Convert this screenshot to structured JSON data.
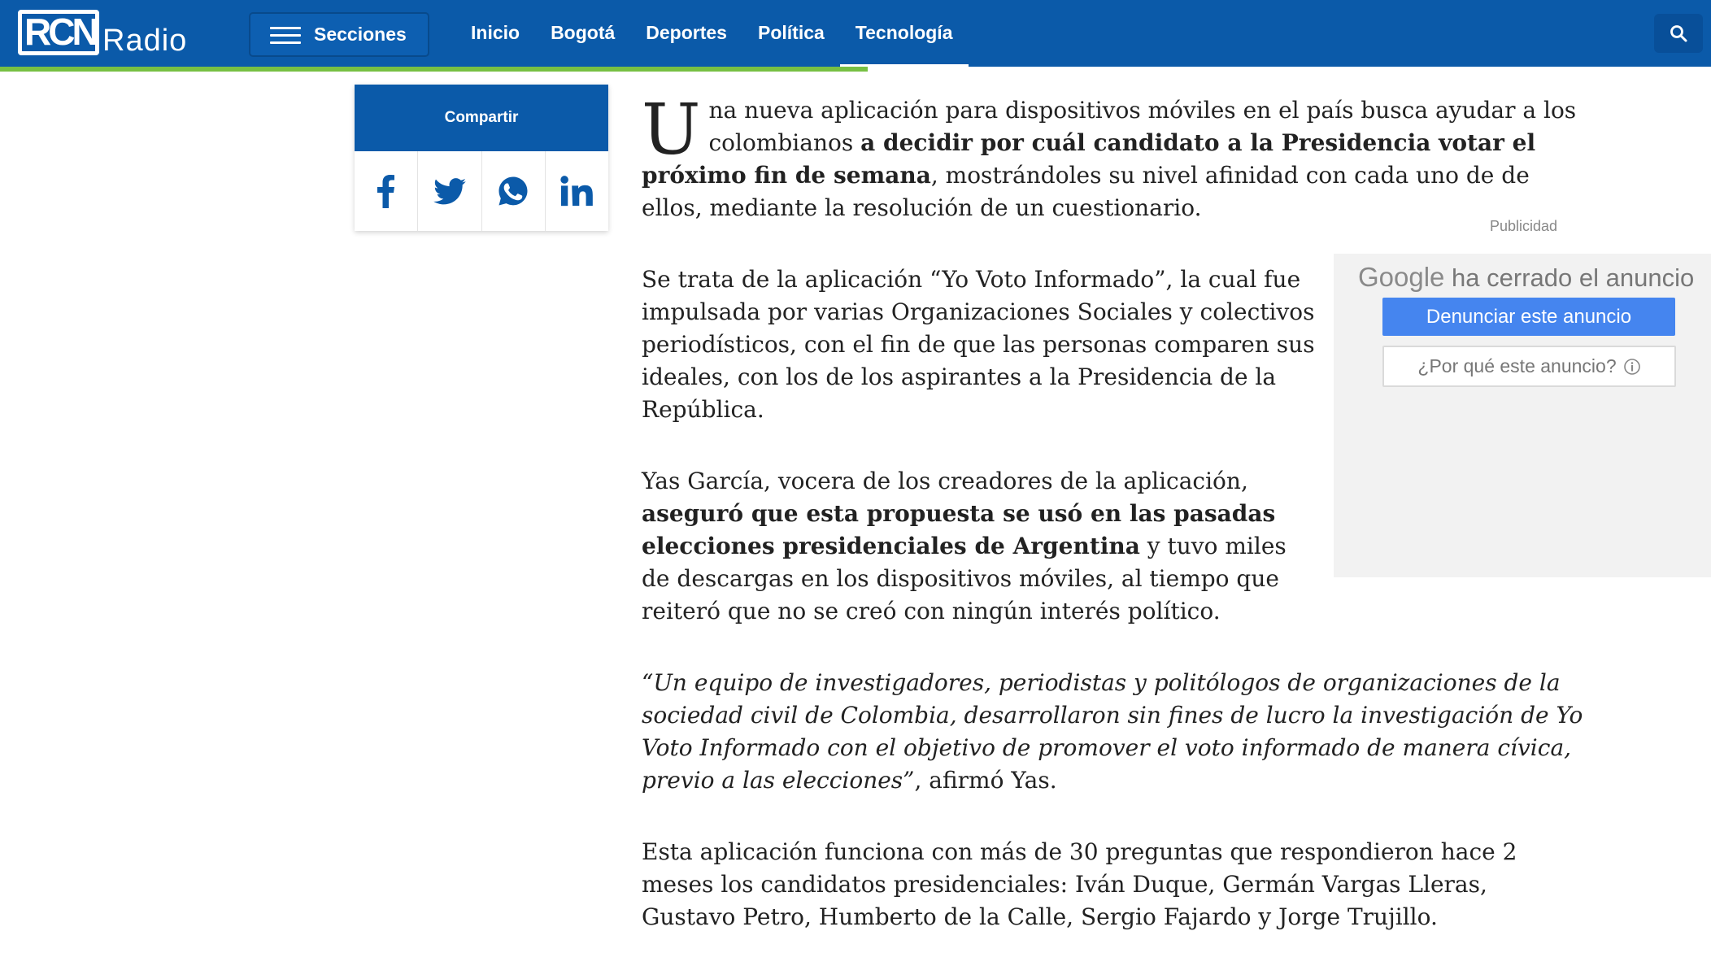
{
  "header": {
    "logo_text": "RCN",
    "logo_word": "Radio",
    "secciones_label": "Secciones",
    "nav": [
      "Inicio",
      "Bogotá",
      "Deportes",
      "Política",
      "Tecnología"
    ],
    "active_nav": "Tecnología",
    "brand_color": "#0b5aa9",
    "progress_color": "#77c043",
    "reading_progress_percent": 50.7
  },
  "share": {
    "label": "Compartir",
    "icons": [
      "facebook-icon",
      "twitter-icon",
      "whatsapp-icon",
      "linkedin-icon"
    ]
  },
  "article": {
    "p1": {
      "dropcap": "U",
      "t1": "na nueva aplicación para dispositivos móviles en el país busca ayudar a los colombianos ",
      "b1": "a decidir por cuál candidato a la Presidencia votar el próximo fin de semana",
      "t2": ", mostrándoles su nivel afinidad con cada uno de de ellos, mediante la resolución de un cuestionario."
    },
    "p2": "Se trata de la aplicación “Yo Voto Informado”, la cual fue impulsada por varias Organizaciones Sociales y colectivos periodísticos, con el fin de que las personas comparen sus ideales, con los de los aspirantes a la Presidencia de la República.",
    "p3": {
      "t1": "Yas García, vocera de los creadores de la aplicación, ",
      "b1": "aseguró que esta propuesta se usó en las pasadas elecciones presidenciales de Argentina",
      "t2": " y tuvo miles de descargas en los dispositivos móviles, al tiempo que reiteró que no se creó con ningún interés político."
    },
    "p4": {
      "quote": "“Un equipo de investigadores, periodistas y politólogos de organizaciones de la sociedad civil de Colombia, desarrollaron sin fines de lucro la investigación de Yo Voto Informado con el objetivo de promover el voto informado de manera cívica, previo a las elecciones”",
      "t1": ", afirmó Yas."
    },
    "p5": "Esta aplicación funciona con más de 30 preguntas que respondieron hace 2 meses los candidatos presidenciales: Iván Duque, Germán Vargas Lleras, Gustavo Petro, Humberto de la Calle, Sergio Fajardo y Jorge Trujillo."
  },
  "ad": {
    "publicidad_label": "Publicidad",
    "google_label": "Google",
    "closed_text": "ha cerrado el anuncio",
    "report_button": "Denunciar este anuncio",
    "why_button": "¿Por qué este anuncio?",
    "why_icon": "info-icon"
  }
}
